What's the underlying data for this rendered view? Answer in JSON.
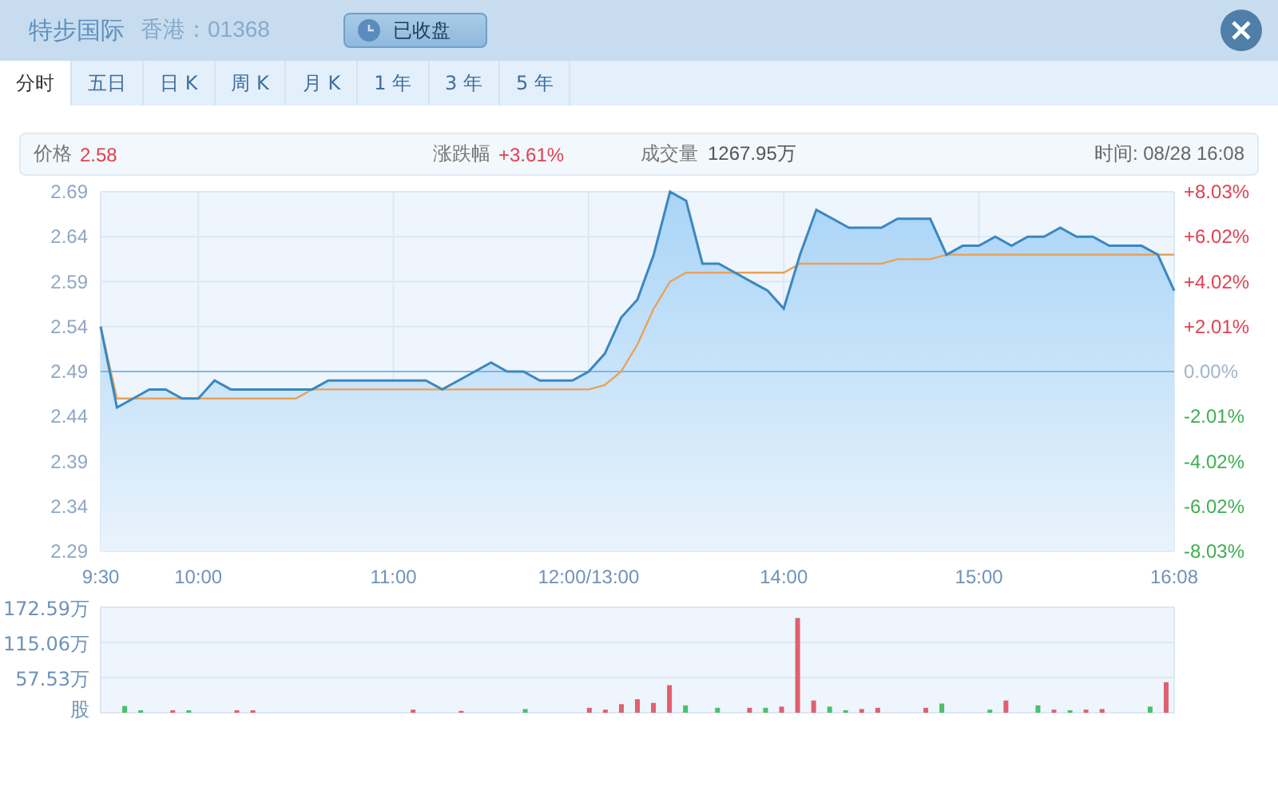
{
  "header": {
    "name": "特步国际",
    "market": "香港：01368",
    "status_button": "已收盘"
  },
  "tabs": [
    {
      "label": "分时",
      "selected": true
    },
    {
      "label": "五日",
      "selected": false
    },
    {
      "label": "日 K",
      "selected": false
    },
    {
      "label": "周 K",
      "selected": false
    },
    {
      "label": "月 K",
      "selected": false
    },
    {
      "label": "1 年",
      "selected": false
    },
    {
      "label": "3 年",
      "selected": false
    },
    {
      "label": "5 年",
      "selected": false
    }
  ],
  "info_bar": {
    "price_label": "价格",
    "price": "2.58",
    "change_label": "涨跌幅",
    "change": "+3.61%",
    "volume_label": "成交量",
    "volume": "1267.95万",
    "time": "时间: 08/28 16:08"
  },
  "price_chart": {
    "right_axis": [
      {
        "label": "+8.03%",
        "kind": "up"
      },
      {
        "label": "+6.02%",
        "kind": "up"
      },
      {
        "label": "+4.02%",
        "kind": "up"
      },
      {
        "label": "+2.01%",
        "kind": "up"
      },
      {
        "label": "0.00%",
        "kind": "flat"
      },
      {
        "label": "-2.01%",
        "kind": "down"
      },
      {
        "label": "-4.02%",
        "kind": "down"
      },
      {
        "label": "-6.02%",
        "kind": "down"
      },
      {
        "label": "-8.03%",
        "kind": "down"
      }
    ],
    "chart_data": {
      "type": "area",
      "grid": true,
      "ylim": [
        2.29,
        2.69
      ],
      "yticks": [
        2.29,
        2.34,
        2.39,
        2.44,
        2.49,
        2.54,
        2.59,
        2.64,
        2.69
      ],
      "categories": [
        "9:30",
        null,
        null,
        null,
        null,
        null,
        "10:00",
        null,
        null,
        null,
        null,
        null,
        null,
        null,
        null,
        null,
        null,
        null,
        "11:00",
        null,
        null,
        null,
        null,
        null,
        null,
        null,
        null,
        null,
        null,
        null,
        "12:00/13:00",
        null,
        null,
        null,
        null,
        null,
        null,
        null,
        null,
        null,
        null,
        null,
        "14:00",
        null,
        null,
        null,
        null,
        null,
        null,
        null,
        null,
        null,
        null,
        null,
        "15:00",
        null,
        null,
        null,
        null,
        null,
        null,
        null,
        null,
        null,
        null,
        null,
        "16:08"
      ],
      "series": [
        {
          "type": "area",
          "color": "#3a87c0",
          "values": [
            2.54,
            2.45,
            2.46,
            2.47,
            2.47,
            2.46,
            2.46,
            2.48,
            2.47,
            2.47,
            2.47,
            2.47,
            2.47,
            2.47,
            2.48,
            2.48,
            2.48,
            2.48,
            2.48,
            2.48,
            2.48,
            2.47,
            2.48,
            2.49,
            2.5,
            2.49,
            2.49,
            2.48,
            2.48,
            2.48,
            2.49,
            2.51,
            2.55,
            2.57,
            2.62,
            2.69,
            2.68,
            2.61,
            2.61,
            2.6,
            2.59,
            2.58,
            2.56,
            2.62,
            2.67,
            2.66,
            2.65,
            2.65,
            2.65,
            2.66,
            2.66,
            2.66,
            2.62,
            2.63,
            2.63,
            2.64,
            2.63,
            2.64,
            2.64,
            2.65,
            2.64,
            2.64,
            2.63,
            2.63,
            2.63,
            2.62,
            2.58
          ]
        },
        {
          "type": "line",
          "color": "#e8a25a",
          "values": [
            2.54,
            2.46,
            2.46,
            2.46,
            2.46,
            2.46,
            2.46,
            2.46,
            2.46,
            2.46,
            2.46,
            2.46,
            2.46,
            2.47,
            2.47,
            2.47,
            2.47,
            2.47,
            2.47,
            2.47,
            2.47,
            2.47,
            2.47,
            2.47,
            2.47,
            2.47,
            2.47,
            2.47,
            2.47,
            2.47,
            2.47,
            2.475,
            2.49,
            2.52,
            2.56,
            2.59,
            2.6,
            2.6,
            2.6,
            2.6,
            2.6,
            2.6,
            2.6,
            2.61,
            2.61,
            2.61,
            2.61,
            2.61,
            2.61,
            2.615,
            2.615,
            2.615,
            2.62,
            2.62,
            2.62,
            2.62,
            2.62,
            2.62,
            2.62,
            2.62,
            2.62,
            2.62,
            2.62,
            2.62,
            2.62,
            2.62,
            2.62
          ]
        }
      ],
      "ref_lines": [
        {
          "axis": "y",
          "value": 2.49
        }
      ]
    }
  },
  "volume_chart": {
    "chart_data": {
      "type": "bar",
      "ylim": [
        0,
        172.59
      ],
      "yticks": [
        {
          "value": 0,
          "label": "股"
        },
        {
          "value": 57.53,
          "label": "57.53万"
        },
        {
          "value": 115.06,
          "label": "115.06万"
        },
        {
          "value": 172.59,
          "label": "172.59万"
        }
      ],
      "categories": [
        null,
        null,
        null,
        null,
        null,
        null,
        null,
        null,
        null,
        null,
        null,
        null,
        null,
        null,
        null,
        null,
        null,
        null,
        null,
        null,
        null,
        null,
        null,
        null,
        null,
        null,
        null,
        null,
        null,
        null,
        null,
        null,
        null,
        null,
        null,
        null,
        null,
        null,
        null,
        null,
        null,
        null,
        null,
        null,
        null,
        null,
        null,
        null,
        null,
        null,
        null,
        null,
        null,
        null,
        null,
        null,
        null,
        null,
        null,
        null,
        null,
        null,
        null,
        null,
        null,
        null,
        null
      ],
      "series": [
        {
          "values": [
            0,
            11,
            4,
            0,
            4,
            4,
            0,
            0,
            4,
            4,
            0,
            0,
            0,
            0,
            0,
            0,
            0,
            0,
            0,
            5,
            0,
            0,
            3,
            0,
            0,
            0,
            6,
            0,
            0,
            0,
            8,
            5,
            14,
            22,
            16,
            45,
            12,
            0,
            8,
            0,
            8,
            8,
            10,
            155,
            20,
            10,
            4,
            6,
            8,
            0,
            0,
            8,
            15,
            0,
            0,
            5,
            20,
            0,
            12,
            5,
            4,
            5,
            6,
            0,
            0,
            10,
            50
          ],
          "colors": [
            "#e06070",
            "#4cbf6a",
            "#4cbf6a",
            "#e06070",
            "#e06070",
            "#4cbf6a",
            "#e06070",
            "#e06070",
            "#e06070",
            "#e06070",
            "#e06070",
            "#e06070",
            "#e06070",
            "#e06070",
            "#e06070",
            "#e06070",
            "#e06070",
            "#e06070",
            "#e06070",
            "#e06070",
            "#e06070",
            "#e06070",
            "#e06070",
            "#e06070",
            "#e06070",
            "#e06070",
            "#4cbf6a",
            "#e06070",
            "#e06070",
            "#e06070",
            "#e06070",
            "#e06070",
            "#e06070",
            "#e06070",
            "#e06070",
            "#e06070",
            "#4cbf6a",
            "#e06070",
            "#4cbf6a",
            "#e06070",
            "#e06070",
            "#4cbf6a",
            "#e06070",
            "#e06070",
            "#e06070",
            "#4cbf6a",
            "#4cbf6a",
            "#e06070",
            "#e06070",
            "#e06070",
            "#e06070",
            "#e06070",
            "#4cbf6a",
            "#e06070",
            "#e06070",
            "#4cbf6a",
            "#e06070",
            "#e06070",
            "#4cbf6a",
            "#e06070",
            "#4cbf6a",
            "#e06070",
            "#e06070",
            "#e06070",
            "#e06070",
            "#4cbf6a",
            "#e06070"
          ]
        }
      ]
    }
  }
}
